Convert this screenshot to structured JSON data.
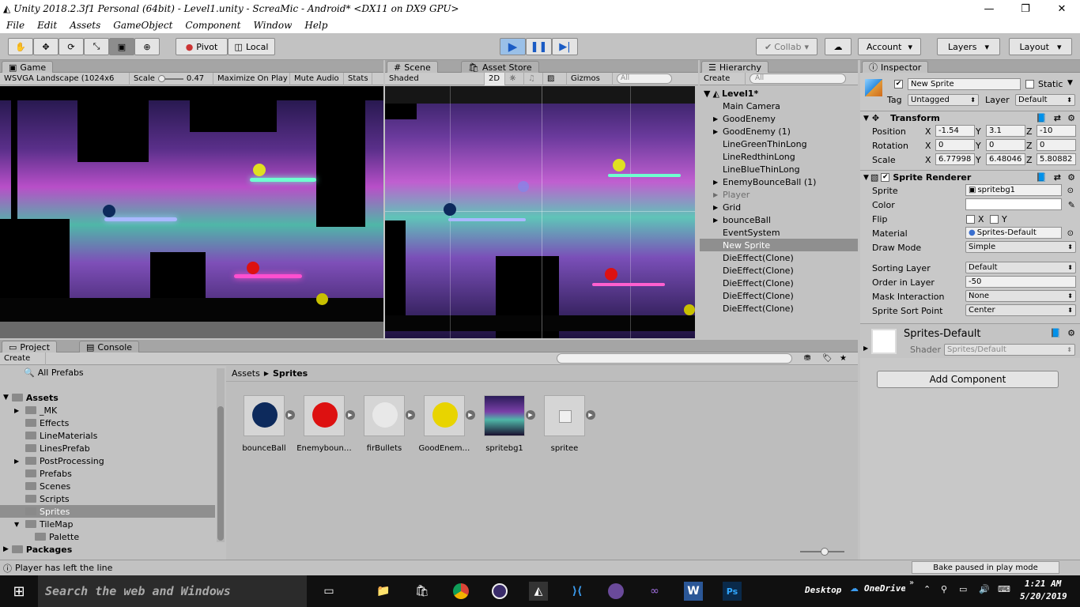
{
  "window": {
    "title": "Unity 2018.2.3f1 Personal (64bit) - Level1.unity - ScreaMic - Android* <DX11 on DX9 GPU>",
    "minimize": "—",
    "restore": "❐",
    "close": "✕"
  },
  "menu": [
    "File",
    "Edit",
    "Assets",
    "GameObject",
    "Component",
    "Window",
    "Help"
  ],
  "toolbar": {
    "pivot": "Pivot",
    "local": "Local",
    "collab": "Collab",
    "account": "Account",
    "layers": "Layers",
    "layout": "Layout"
  },
  "game": {
    "tab": "Game",
    "resolution": "WSVGA Landscape (1024x6",
    "scale_label": "Scale",
    "scale_value": "0.47",
    "maximize": "Maximize On Play",
    "mute": "Mute Audio",
    "stats": "Stats"
  },
  "scene": {
    "tab": "Scene",
    "asset_store_tab": "Asset Store",
    "shading": "Shaded",
    "mode2d": "2D",
    "gizmos": "Gizmos",
    "search_placeholder": "All"
  },
  "hierarchy": {
    "tab": "Hierarchy",
    "create": "Create",
    "search_placeholder": "All",
    "scene_name": "Level1*",
    "items": [
      {
        "label": "Main Camera",
        "arrow": ""
      },
      {
        "label": "GoodEnemy",
        "arrow": "▶"
      },
      {
        "label": "GoodEnemy (1)",
        "arrow": "▶"
      },
      {
        "label": "LineGreenThinLong",
        "arrow": ""
      },
      {
        "label": "LineRedthinLong",
        "arrow": ""
      },
      {
        "label": "LineBlueThinLong",
        "arrow": ""
      },
      {
        "label": "EnemyBounceBall (1)",
        "arrow": "▶"
      },
      {
        "label": "Player",
        "arrow": "▶"
      },
      {
        "label": "Grid",
        "arrow": "▶"
      },
      {
        "label": "bounceBall",
        "arrow": "▶"
      },
      {
        "label": "EventSystem",
        "arrow": ""
      },
      {
        "label": "New Sprite",
        "arrow": ""
      },
      {
        "label": "DieEffect(Clone)",
        "arrow": ""
      },
      {
        "label": "DieEffect(Clone)",
        "arrow": ""
      },
      {
        "label": "DieEffect(Clone)",
        "arrow": ""
      },
      {
        "label": "DieEffect(Clone)",
        "arrow": ""
      },
      {
        "label": "DieEffect(Clone)",
        "arrow": ""
      }
    ]
  },
  "inspector": {
    "tab": "Inspector",
    "object_name": "New Sprite",
    "static_label": "Static",
    "tag_label": "Tag",
    "tag_value": "Untagged",
    "layer_label": "Layer",
    "layer_value": "Default",
    "transform": {
      "title": "Transform",
      "position": {
        "label": "Position",
        "x": "-1.54",
        "y": "3.1",
        "z": "-10"
      },
      "rotation": {
        "label": "Rotation",
        "x": "0",
        "y": "0",
        "z": "0"
      },
      "scale": {
        "label": "Scale",
        "x": "6.77998",
        "y": "6.48046",
        "z": "5.80882"
      }
    },
    "sprite_renderer": {
      "title": "Sprite Renderer",
      "sprite_label": "Sprite",
      "sprite_value": "spritebg1",
      "color_label": "Color",
      "flip_label": "Flip",
      "flip_x": "X",
      "flip_y": "Y",
      "material_label": "Material",
      "material_value": "Sprites-Default",
      "draw_mode_label": "Draw Mode",
      "draw_mode_value": "Simple",
      "sorting_layer_label": "Sorting Layer",
      "sorting_layer_value": "Default",
      "order_label": "Order in Layer",
      "order_value": "-50",
      "mask_label": "Mask Interaction",
      "mask_value": "None",
      "sort_point_label": "Sprite Sort Point",
      "sort_point_value": "Center"
    },
    "material": {
      "name": "Sprites-Default",
      "shader_label": "Shader",
      "shader_value": "Sprites/Default"
    },
    "add_component": "Add Component"
  },
  "project": {
    "tab": "Project",
    "console_tab": "Console",
    "create": "Create",
    "favorites": "All Prefabs",
    "assets_root": "Assets",
    "folders": [
      {
        "label": "_MK",
        "arrow": "▶"
      },
      {
        "label": "Effects",
        "arrow": ""
      },
      {
        "label": "LineMaterials",
        "arrow": ""
      },
      {
        "label": "LinesPrefab",
        "arrow": ""
      },
      {
        "label": "PostProcessing",
        "arrow": "▶"
      },
      {
        "label": "Prefabs",
        "arrow": ""
      },
      {
        "label": "Scenes",
        "arrow": ""
      },
      {
        "label": "Scripts",
        "arrow": ""
      },
      {
        "label": "Sprites",
        "arrow": ""
      },
      {
        "label": "TileMap",
        "arrow": "▼"
      }
    ],
    "subfolder": "Palette",
    "packages": "Packages",
    "breadcrumb_root": "Assets",
    "breadcrumb_current": "Sprites",
    "assets": [
      {
        "label": "bounceBall",
        "color": "#0d2a5c"
      },
      {
        "label": "Enemyboun…",
        "color": "#dd1111"
      },
      {
        "label": "firBullets",
        "color": "#e8e8e8"
      },
      {
        "label": "GoodEnem…",
        "color": "#e8d400"
      },
      {
        "label": "spritebg1",
        "color": "#7a3fa8"
      },
      {
        "label": "spritee",
        "color": "#f0f0f0"
      }
    ]
  },
  "status": {
    "message": "Player has left the line",
    "bake": "Bake paused in play mode"
  },
  "taskbar": {
    "search": "Search the web and Windows",
    "desktop": "Desktop",
    "onedrive": "OneDrive",
    "time": "1:21 AM",
    "date": "5/20/2019"
  }
}
